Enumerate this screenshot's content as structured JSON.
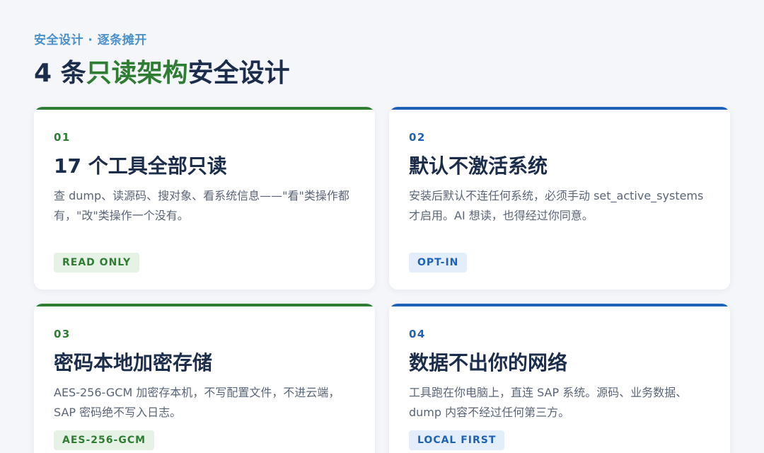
{
  "header": {
    "eyebrow": "安全设计 · 逐条摊开",
    "title_prefix": "4 条",
    "title_highlight": "只读架构",
    "title_suffix": "安全设计"
  },
  "cards": [
    {
      "num": "01",
      "title": "17 个工具全部只读",
      "desc": "查 dump、读源码、搜对象、看系统信息——\"看\"类操作都有，\"改\"类操作一个没有。",
      "tag": "READ ONLY",
      "accent": "#2e7d32"
    },
    {
      "num": "02",
      "title": "默认不激活系统",
      "desc": "安装后默认不连任何系统，必须手动 set_active_systems 才启用。AI 想读，也得经过你同意。",
      "tag": "OPT-IN",
      "accent": "#1e62b8"
    },
    {
      "num": "03",
      "title": "密码本地加密存储",
      "desc": "AES-256-GCM 加密存本机，不写配置文件，不进云端，SAP 密码绝不写入日志。",
      "tag": "AES-256-GCM",
      "accent": "#2e7d32"
    },
    {
      "num": "04",
      "title": "数据不出你的网络",
      "desc": "工具跑在你电脑上，直连 SAP 系统。源码、业务数据、dump 内容不经过任何第三方。",
      "tag": "LOCAL FIRST",
      "accent": "#1e62b8"
    }
  ]
}
